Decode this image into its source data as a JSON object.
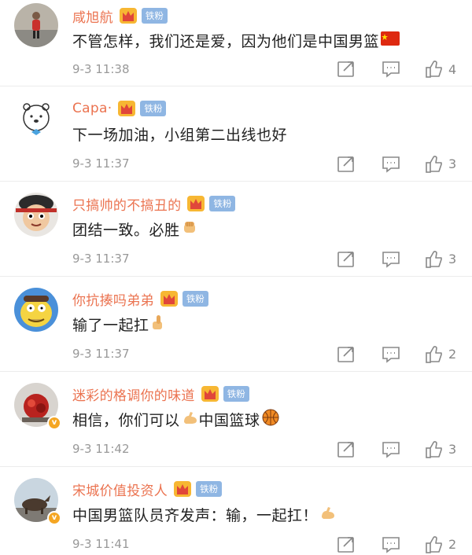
{
  "badges": {
    "fan_label": "铁粉",
    "verified_mark": "v"
  },
  "colors": {
    "username": "#eb7350",
    "fan_badge": "#8fb6e3",
    "crown": "#f5a623",
    "time": "#999999"
  },
  "icons": {
    "forward": "forward-icon",
    "reply": "comment-icon",
    "like": "thumb-up-icon",
    "crown": "crown-icon"
  },
  "comments": [
    {
      "username": "咸旭航",
      "text": "不管怎样，我们还是爱，因为他们是中国男篮",
      "emoji": "china-flag-icon",
      "time": "9-3 11:38",
      "likes": "4",
      "avatar": "child-photo",
      "verified": false
    },
    {
      "username": "Capa·",
      "text": "下一场加油，小组第二出线也好",
      "emoji": "",
      "time": "9-3 11:37",
      "likes": "3",
      "avatar": "bear-cartoon",
      "verified": false
    },
    {
      "username": "只搞帅的不搞丑的",
      "text": "团结一致。必胜",
      "emoji": "fist-emoji-icon",
      "time": "9-3 11:37",
      "likes": "3",
      "avatar": "cartoon-boy",
      "verified": false
    },
    {
      "username": "你抗揍吗弟弟",
      "text": "输了一起扛",
      "emoji": "thumbs-up-emoji-icon",
      "time": "9-3 11:37",
      "likes": "2",
      "avatar": "simpsons-character",
      "verified": false
    },
    {
      "username": "迷彩的格调你的味道",
      "text": "相信，你们可以",
      "text2": "中国篮球",
      "emoji": "muscle-emoji-icon",
      "emoji2": "basketball-emoji-icon",
      "time": "9-3 11:42",
      "likes": "3",
      "avatar": "red-scene-photo",
      "verified": true
    },
    {
      "username": "宋城价值投资人",
      "text": "中国男篮队员齐发声：输，一起扛！",
      "emoji": "muscle-emoji-icon",
      "time": "9-3 11:41",
      "likes": "2",
      "avatar": "bull-statue-photo",
      "verified": true
    }
  ]
}
